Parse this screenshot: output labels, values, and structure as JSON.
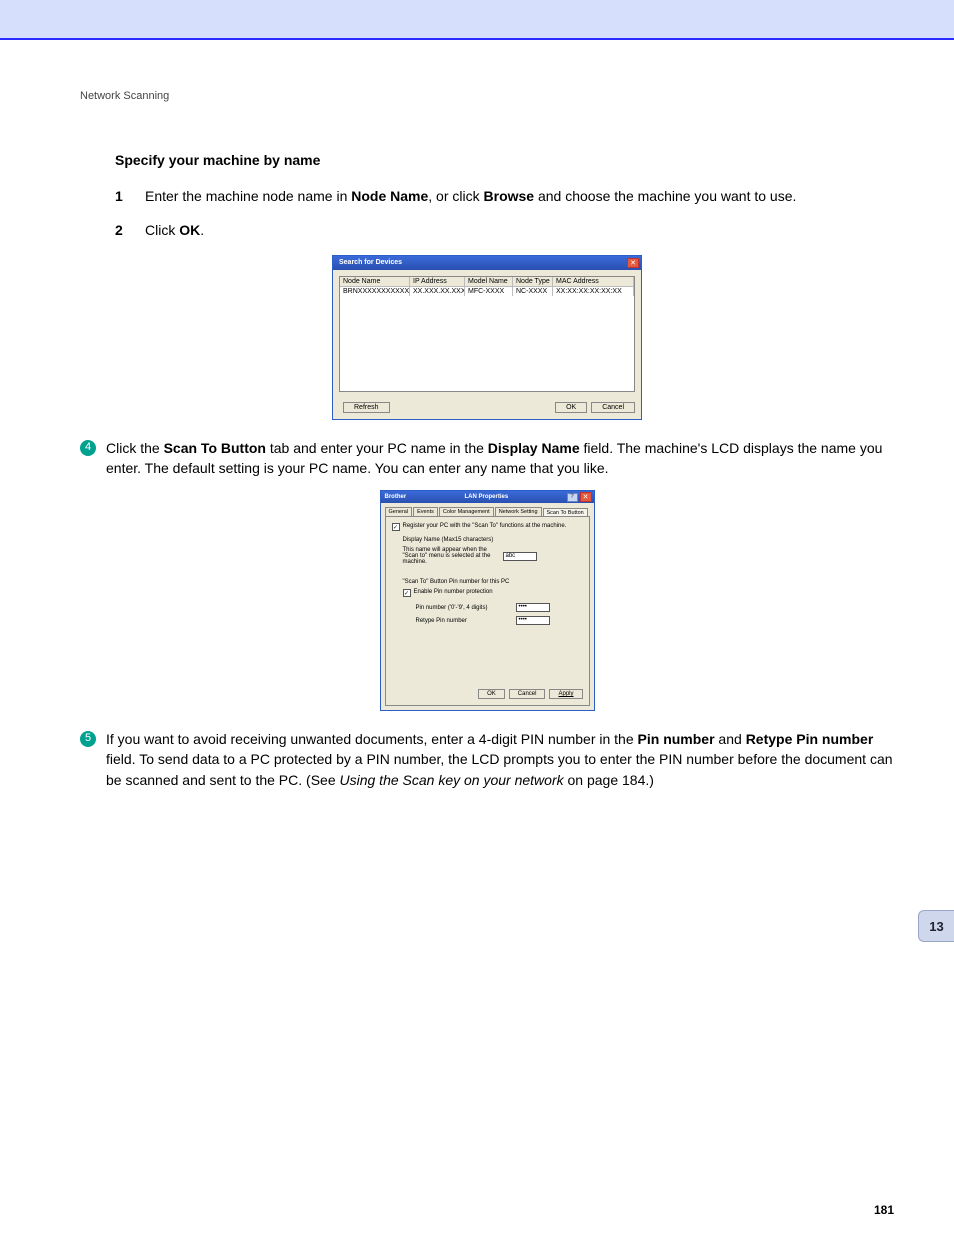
{
  "header": "Network Scanning",
  "section_title": "Specify your machine by name",
  "step1": {
    "num": "1",
    "t1": "Enter the machine node name in ",
    "b1": "Node Name",
    "t2": ", or click ",
    "b2": "Browse",
    "t3": " and choose the machine you want to use."
  },
  "step2": {
    "num": "2",
    "t1": "Click ",
    "b1": "OK",
    "t2": "."
  },
  "dlg1": {
    "title": "Search for Devices",
    "cols": {
      "node": "Node Name",
      "ip": "IP Address",
      "model": "Model Name",
      "ntype": "Node Type",
      "mac": "MAC Address"
    },
    "row": {
      "node": "BRNXXXXXXXXXXXX",
      "ip": "XX.XXX.XX.XXX",
      "model": "MFC-XXXX",
      "ntype": "NC-XXXX",
      "mac": "XX:XX:XX:XX:XX:XX"
    },
    "refresh": "Refresh",
    "ok": "OK",
    "cancel": "Cancel"
  },
  "step4": {
    "badge": "4",
    "t1": "Click the ",
    "b1": "Scan To Button",
    "t2": " tab and enter your PC name in the ",
    "b2": "Display Name",
    "t3": " field. The machine's LCD displays the name you enter. The default setting is your PC name. You can enter any name that you like."
  },
  "dlg2": {
    "title_left": "Brother",
    "title_center": "LAN Properties",
    "tabs": {
      "general": "General",
      "events": "Events",
      "color": "Color Management",
      "net": "Network Setting",
      "scanto": "Scan To Button"
    },
    "register": "Register your PC with the \"Scan To\" functions at the machine.",
    "disp1": "Display Name (Max15 characters)",
    "disp2": "This name will appear when the \"Scan to\" menu is selected at the machine.",
    "disp_value": "abc",
    "pin_head": "\"Scan To\" Button Pin number for this PC",
    "pin_enable": "Enable Pin number protection",
    "pin_label": "Pin number ('0'-'9', 4 digits)",
    "pin_value": "••••",
    "retype_label": "Retype Pin number",
    "retype_value": "••••",
    "ok": "OK",
    "cancel": "Cancel",
    "apply": "Apply"
  },
  "step5": {
    "badge": "5",
    "t1": "If you want to avoid receiving unwanted documents, enter a 4-digit PIN number in the ",
    "b1": "Pin number",
    "t2": " and ",
    "b2": "Retype Pin number",
    "t3": " field. To send data to a PC protected by a PIN number, the LCD prompts you to enter the PIN number before the document can be scanned and sent to the PC. (See ",
    "i1": "Using the Scan key on your network",
    "t4": " on page 184.)"
  },
  "sidetab": "13",
  "pagenum": "181"
}
